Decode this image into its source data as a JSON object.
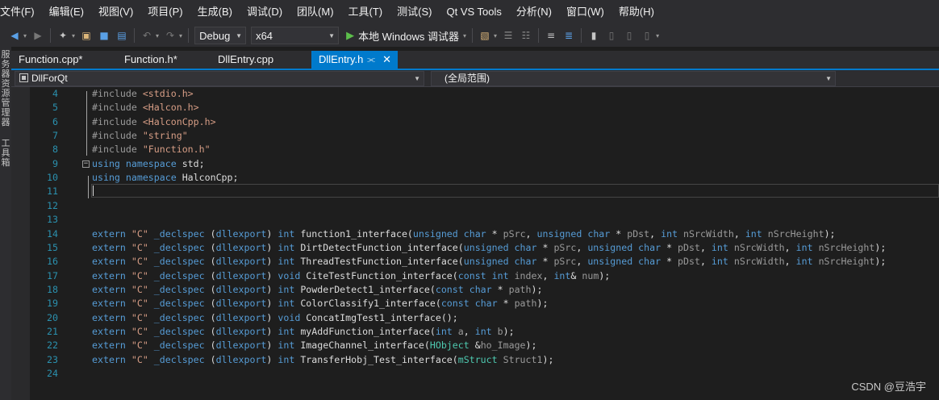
{
  "menu": [
    "文件(F)",
    "编辑(E)",
    "视图(V)",
    "项目(P)",
    "生成(B)",
    "调试(D)",
    "团队(M)",
    "工具(T)",
    "测试(S)",
    "Qt VS Tools",
    "分析(N)",
    "窗口(W)",
    "帮助(H)"
  ],
  "toolbar": {
    "config": "Debug",
    "platform": "x64",
    "run_label": "本地 Windows 调试器"
  },
  "left_strip": {
    "panel1": "服务器资源管理器",
    "panel2": "工具箱"
  },
  "tabs": [
    {
      "label": "Function.cpp*",
      "active": false
    },
    {
      "label": "Function.h*",
      "active": false
    },
    {
      "label": "DllEntry.cpp",
      "active": false
    },
    {
      "label": "DllEntry.h",
      "active": true
    }
  ],
  "nav": {
    "project": "DllForQt",
    "scope": "(全局范围)"
  },
  "code": {
    "lines": [
      {
        "n": "4",
        "segs": [
          [
            "pp",
            "#include "
          ],
          [
            "str",
            "<stdio.h>"
          ]
        ]
      },
      {
        "n": "5",
        "segs": [
          [
            "pp",
            "#include "
          ],
          [
            "str",
            "<Halcon.h>"
          ]
        ]
      },
      {
        "n": "6",
        "segs": [
          [
            "pp",
            "#include "
          ],
          [
            "str",
            "<HalconCpp.h>"
          ]
        ]
      },
      {
        "n": "7",
        "segs": [
          [
            "pp",
            "#include "
          ],
          [
            "str",
            "\"string\""
          ]
        ]
      },
      {
        "n": "8",
        "segs": [
          [
            "pp",
            "#include "
          ],
          [
            "str",
            "\"Function.h\""
          ]
        ]
      },
      {
        "n": "9",
        "segs": [
          [
            "kw",
            "using namespace "
          ],
          [
            "fn",
            "std;"
          ]
        ]
      },
      {
        "n": "10",
        "segs": [
          [
            "kw",
            "using namespace "
          ],
          [
            "fn",
            "HalconCpp;"
          ]
        ]
      },
      {
        "n": "11",
        "segs": []
      },
      {
        "n": "12",
        "segs": []
      },
      {
        "n": "13",
        "segs": []
      },
      {
        "n": "14",
        "segs": [
          [
            "kw",
            "extern "
          ],
          [
            "str",
            "\"C\" "
          ],
          [
            "kw",
            "_declspec "
          ],
          [
            "fn",
            "("
          ],
          [
            "kw",
            "dllexport"
          ],
          [
            "fn",
            ") "
          ],
          [
            "kw",
            "int "
          ],
          [
            "fn",
            "function1_interface("
          ],
          [
            "kw",
            "unsigned char "
          ],
          [
            "fn",
            "* "
          ],
          [
            "param",
            "pSrc"
          ],
          [
            "fn",
            ", "
          ],
          [
            "kw",
            "unsigned char "
          ],
          [
            "fn",
            "* "
          ],
          [
            "param",
            "pDst"
          ],
          [
            "fn",
            ", "
          ],
          [
            "kw",
            "int "
          ],
          [
            "param",
            "nSrcWidth"
          ],
          [
            "fn",
            ", "
          ],
          [
            "kw",
            "int "
          ],
          [
            "param",
            "nSrcHeight"
          ],
          [
            "fn",
            ");"
          ]
        ]
      },
      {
        "n": "15",
        "segs": [
          [
            "kw",
            "extern "
          ],
          [
            "str",
            "\"C\" "
          ],
          [
            "kw",
            "_declspec "
          ],
          [
            "fn",
            "("
          ],
          [
            "kw",
            "dllexport"
          ],
          [
            "fn",
            ") "
          ],
          [
            "kw",
            "int "
          ],
          [
            "fn",
            "DirtDetectFunction_interface("
          ],
          [
            "kw",
            "unsigned char "
          ],
          [
            "fn",
            "* "
          ],
          [
            "param",
            "pSrc"
          ],
          [
            "fn",
            ", "
          ],
          [
            "kw",
            "unsigned char "
          ],
          [
            "fn",
            "* "
          ],
          [
            "param",
            "pDst"
          ],
          [
            "fn",
            ", "
          ],
          [
            "kw",
            "int "
          ],
          [
            "param",
            "nSrcWidth"
          ],
          [
            "fn",
            ", "
          ],
          [
            "kw",
            "int "
          ],
          [
            "param",
            "nSrcHeight"
          ],
          [
            "fn",
            ");"
          ]
        ]
      },
      {
        "n": "16",
        "segs": [
          [
            "kw",
            "extern "
          ],
          [
            "str",
            "\"C\" "
          ],
          [
            "kw",
            "_declspec "
          ],
          [
            "fn",
            "("
          ],
          [
            "kw",
            "dllexport"
          ],
          [
            "fn",
            ") "
          ],
          [
            "kw",
            "int "
          ],
          [
            "fn",
            "ThreadTestFunction_interface("
          ],
          [
            "kw",
            "unsigned char "
          ],
          [
            "fn",
            "* "
          ],
          [
            "param",
            "pSrc"
          ],
          [
            "fn",
            ", "
          ],
          [
            "kw",
            "unsigned char "
          ],
          [
            "fn",
            "* "
          ],
          [
            "param",
            "pDst"
          ],
          [
            "fn",
            ", "
          ],
          [
            "kw",
            "int "
          ],
          [
            "param",
            "nSrcWidth"
          ],
          [
            "fn",
            ", "
          ],
          [
            "kw",
            "int "
          ],
          [
            "param",
            "nSrcHeight"
          ],
          [
            "fn",
            ");"
          ]
        ]
      },
      {
        "n": "17",
        "segs": [
          [
            "kw",
            "extern "
          ],
          [
            "str",
            "\"C\" "
          ],
          [
            "kw",
            "_declspec "
          ],
          [
            "fn",
            "("
          ],
          [
            "kw",
            "dllexport"
          ],
          [
            "fn",
            ") "
          ],
          [
            "kw",
            "void "
          ],
          [
            "fn",
            "CiteTestFunction_interface("
          ],
          [
            "kw",
            "const int "
          ],
          [
            "param",
            "index"
          ],
          [
            "fn",
            ", "
          ],
          [
            "kw",
            "int"
          ],
          [
            "fn",
            "& "
          ],
          [
            "param",
            "num"
          ],
          [
            "fn",
            ");"
          ]
        ]
      },
      {
        "n": "18",
        "segs": [
          [
            "kw",
            "extern "
          ],
          [
            "str",
            "\"C\" "
          ],
          [
            "kw",
            "_declspec "
          ],
          [
            "fn",
            "("
          ],
          [
            "kw",
            "dllexport"
          ],
          [
            "fn",
            ") "
          ],
          [
            "kw",
            "int "
          ],
          [
            "fn",
            "PowderDetect1_interface("
          ],
          [
            "kw",
            "const char "
          ],
          [
            "fn",
            "* "
          ],
          [
            "param",
            "path"
          ],
          [
            "fn",
            ");"
          ]
        ]
      },
      {
        "n": "19",
        "segs": [
          [
            "kw",
            "extern "
          ],
          [
            "str",
            "\"C\" "
          ],
          [
            "kw",
            "_declspec "
          ],
          [
            "fn",
            "("
          ],
          [
            "kw",
            "dllexport"
          ],
          [
            "fn",
            ") "
          ],
          [
            "kw",
            "int "
          ],
          [
            "fn",
            "ColorClassify1_interface("
          ],
          [
            "kw",
            "const char "
          ],
          [
            "fn",
            "* "
          ],
          [
            "param",
            "path"
          ],
          [
            "fn",
            ");"
          ]
        ]
      },
      {
        "n": "20",
        "segs": [
          [
            "kw",
            "extern "
          ],
          [
            "str",
            "\"C\" "
          ],
          [
            "kw",
            "_declspec "
          ],
          [
            "fn",
            "("
          ],
          [
            "kw",
            "dllexport"
          ],
          [
            "fn",
            ") "
          ],
          [
            "kw",
            "void "
          ],
          [
            "fn",
            "ConcatImgTest1_interface();"
          ]
        ]
      },
      {
        "n": "21",
        "segs": [
          [
            "kw",
            "extern "
          ],
          [
            "str",
            "\"C\" "
          ],
          [
            "kw",
            "_declspec "
          ],
          [
            "fn",
            "("
          ],
          [
            "kw",
            "dllexport"
          ],
          [
            "fn",
            ") "
          ],
          [
            "kw",
            "int "
          ],
          [
            "fn",
            "myAddFunction_interface("
          ],
          [
            "kw",
            "int "
          ],
          [
            "param",
            "a"
          ],
          [
            "fn",
            ", "
          ],
          [
            "kw",
            "int "
          ],
          [
            "param",
            "b"
          ],
          [
            "fn",
            ");"
          ]
        ]
      },
      {
        "n": "22",
        "segs": [
          [
            "kw",
            "extern "
          ],
          [
            "str",
            "\"C\" "
          ],
          [
            "kw",
            "_declspec "
          ],
          [
            "fn",
            "("
          ],
          [
            "kw",
            "dllexport"
          ],
          [
            "fn",
            ") "
          ],
          [
            "kw",
            "int "
          ],
          [
            "fn",
            "ImageChannel_interface("
          ],
          [
            "type",
            "HObject "
          ],
          [
            "fn",
            "&"
          ],
          [
            "param",
            "ho_Image"
          ],
          [
            "fn",
            ");"
          ]
        ]
      },
      {
        "n": "23",
        "segs": [
          [
            "kw",
            "extern "
          ],
          [
            "str",
            "\"C\" "
          ],
          [
            "kw",
            "_declspec "
          ],
          [
            "fn",
            "("
          ],
          [
            "kw",
            "dllexport"
          ],
          [
            "fn",
            ") "
          ],
          [
            "kw",
            "int "
          ],
          [
            "fn",
            "TransferHobj_Test_interface("
          ],
          [
            "type",
            "mStruct "
          ],
          [
            "param",
            "Struct1"
          ],
          [
            "fn",
            ");"
          ]
        ]
      },
      {
        "n": "24",
        "segs": []
      }
    ]
  },
  "watermark": "CSDN @豆浩宇",
  "colors": {
    "accent": "#007acc",
    "keyword": "#569cd6",
    "string": "#d69d85",
    "line_number": "#2b91af"
  }
}
